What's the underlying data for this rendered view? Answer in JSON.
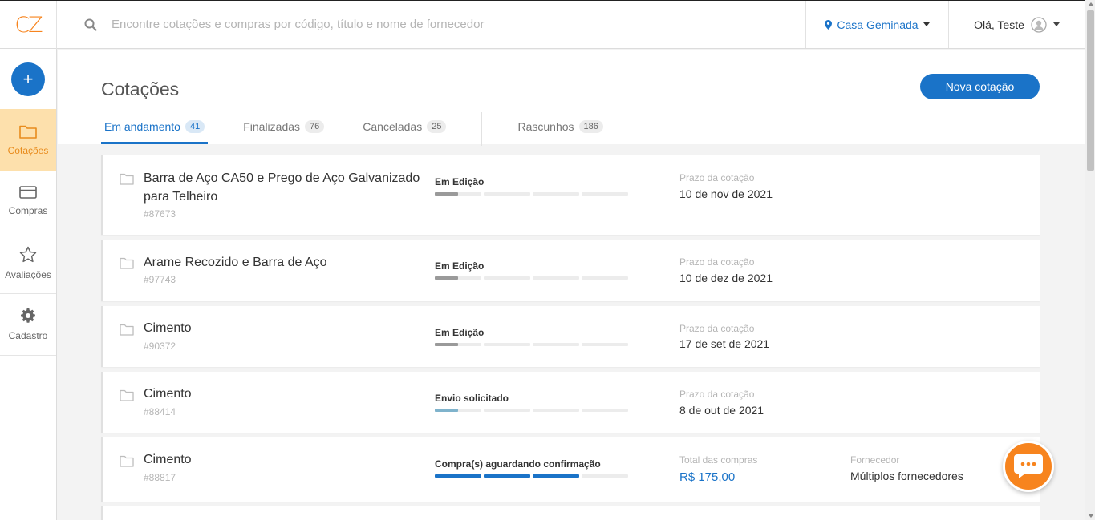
{
  "brand": {
    "logo": "CZ"
  },
  "search": {
    "placeholder": "Encontre cotações e compras por código, título e nome de fornecedor"
  },
  "location": {
    "label": "Casa Geminada"
  },
  "user": {
    "greeting": "Olá, Teste"
  },
  "sidebar": {
    "add_label": "+",
    "items": [
      {
        "label": "Cotações",
        "icon": "folder-icon",
        "active": true
      },
      {
        "label": "Compras",
        "icon": "card-icon",
        "active": false
      },
      {
        "label": "Avaliações",
        "icon": "star-icon",
        "active": false
      },
      {
        "label": "Cadastro",
        "icon": "gear-icon",
        "active": false
      }
    ]
  },
  "page": {
    "title": "Cotações",
    "new_button": "Nova cotação",
    "tabs": [
      {
        "label": "Em andamento",
        "count": "41",
        "active": true
      },
      {
        "label": "Finalizadas",
        "count": "76",
        "active": false
      },
      {
        "label": "Canceladas",
        "count": "25",
        "active": false
      },
      {
        "label": "Rascunhos",
        "count": "186",
        "active": false
      }
    ]
  },
  "quotes": [
    {
      "title": "Barra de Aço CA50 e Prego de Aço Galvanizado para Telheiro",
      "code": "#87673",
      "status": "Em Edição",
      "filled_segments": 1,
      "segment_color": "#9a9a9a",
      "meta_label": "Prazo da cotação",
      "meta_value": "10 de nov de 2021"
    },
    {
      "title": "Arame Recozido e Barra de Aço",
      "code": "#97743",
      "status": "Em Edição",
      "filled_segments": 1,
      "segment_color": "#9a9a9a",
      "meta_label": "Prazo da cotação",
      "meta_value": "10 de dez de 2021"
    },
    {
      "title": "Cimento",
      "code": "#90372",
      "status": "Em Edição",
      "filled_segments": 1,
      "segment_color": "#9a9a9a",
      "meta_label": "Prazo da cotação",
      "meta_value": "17 de set de 2021"
    },
    {
      "title": "Cimento",
      "code": "#88414",
      "status": "Envio solicitado",
      "filled_segments": 1,
      "segment_color": "#7fb3cc",
      "meta_label": "Prazo da cotação",
      "meta_value": "8 de out de 2021"
    },
    {
      "title": "Cimento",
      "code": "#88817",
      "status": "Compra(s) aguardando confirmação",
      "filled_segments": 3,
      "segment_color": "#1a73c8",
      "meta_label": "Total das compras",
      "meta_value": "R$ 175,00",
      "supplier_label": "Fornecedor",
      "supplier_value": "Múltiplos fornecedores"
    }
  ],
  "colors": {
    "accent": "#1a73c8",
    "brand": "#f7841e",
    "active_nav_bg": "#fde0ac"
  }
}
